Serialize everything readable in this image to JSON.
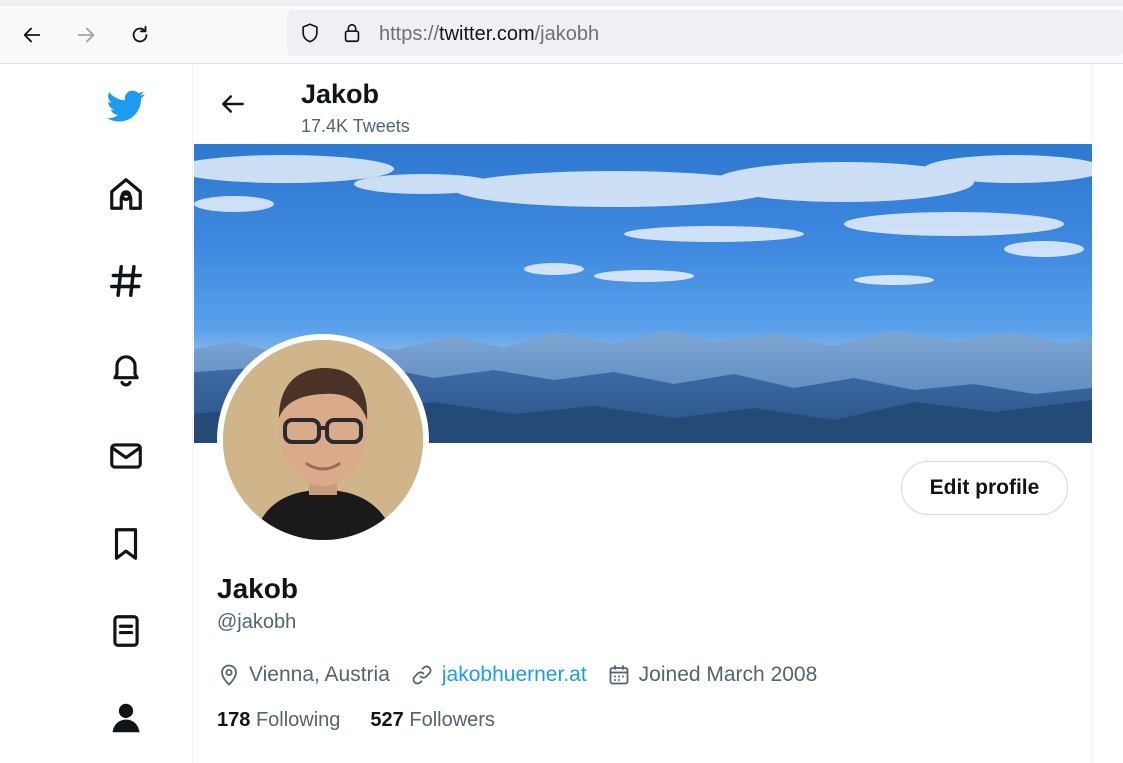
{
  "browser": {
    "url_protocol": "https://",
    "url_domain": "twitter.com",
    "url_path": "/jakobh"
  },
  "sidebar": {
    "items": [
      {
        "icon": "twitter-bird-icon"
      },
      {
        "icon": "home-icon"
      },
      {
        "icon": "hashtag-explore-icon"
      },
      {
        "icon": "bell-notifications-icon"
      },
      {
        "icon": "envelope-messages-icon"
      },
      {
        "icon": "bookmark-icon"
      },
      {
        "icon": "list-icon"
      },
      {
        "icon": "profile-icon"
      }
    ]
  },
  "header": {
    "name": "Jakob",
    "tweet_count": "17.4K Tweets"
  },
  "profile": {
    "edit_label": "Edit profile",
    "name": "Jakob",
    "handle": "@jakobh",
    "location": "Vienna, Austria",
    "website": "jakobhuerner.at",
    "joined": "Joined March 2008",
    "following_count": "178",
    "following_label": "Following",
    "followers_count": "527",
    "followers_label": "Followers"
  },
  "colors": {
    "twitter_blue": "#1d9bf0",
    "text_primary": "#0f1419",
    "text_secondary": "#536471"
  }
}
